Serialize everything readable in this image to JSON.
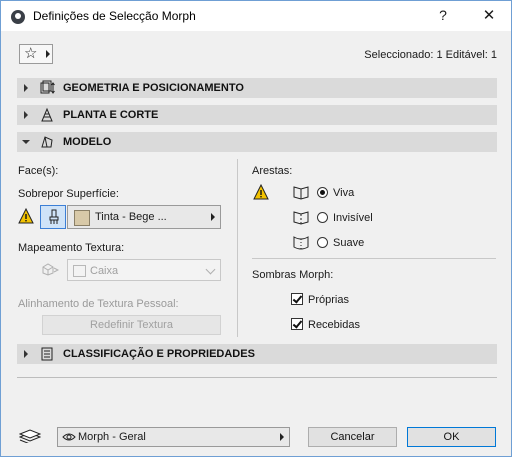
{
  "window": {
    "title": "Definições de Selecção Morph",
    "help": "?",
    "close": "✕"
  },
  "toolbar": {
    "favorites_icon": "star-icon",
    "selection_info": "Seleccionado: 1 Editável: 1"
  },
  "sections": {
    "geometry": "GEOMETRIA E POSICIONAMENTO",
    "floorplan": "PLANTA E CORTE",
    "model": "MODELO",
    "classification": "CLASSIFICAÇÃO E PROPRIEDADES"
  },
  "model": {
    "faces_label": "Face(s):",
    "override_label": "Sobrepor Superfície:",
    "surface_value": "Tinta - Bege ...",
    "surface_color": "#d8c9a8",
    "texture_mapping_label": "Mapeamento Textura:",
    "texture_mapping_value": "Caixa",
    "texture_alignment_label": "Alinhamento de Textura Pessoal:",
    "reset_texture_button": "Redefinir Textura",
    "edges_label": "Arestas:",
    "edges_options": [
      "Viva",
      "Invisível",
      "Suave"
    ],
    "edges_selected": "Viva",
    "shadows_label": "Sombras Morph:",
    "shadow_own": "Próprias",
    "shadow_received": "Recebidas"
  },
  "footer": {
    "view_value": "Morph - Geral",
    "cancel": "Cancelar",
    "ok": "OK"
  },
  "colors": {
    "accent": "#3c7fd6",
    "section_bg": "#dadada",
    "warning": "#f2c200"
  }
}
